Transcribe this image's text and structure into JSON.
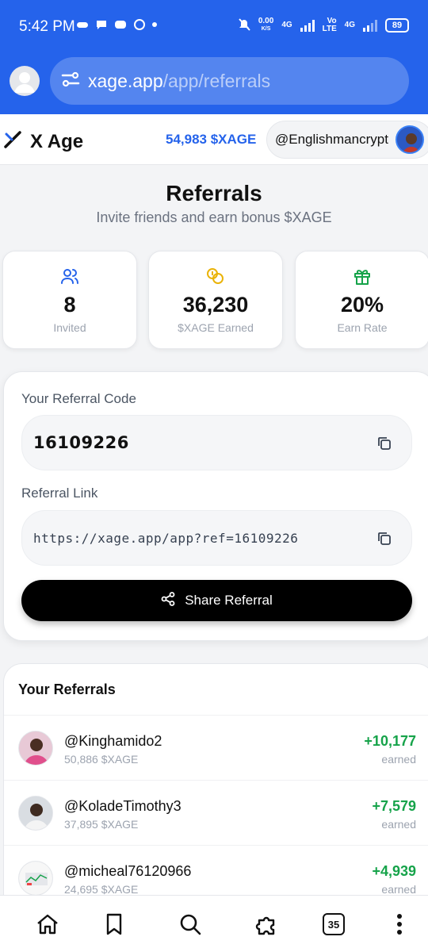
{
  "status_bar": {
    "time": "5:42 PM",
    "net_speed_value": "0.00",
    "net_speed_unit": "K/S",
    "sim1_label": "4G",
    "volte_label": "Vo LTE",
    "sim2_label": "4G",
    "battery": "89"
  },
  "browser": {
    "url_host": "xage.app",
    "url_path": "/app/referrals"
  },
  "app_header": {
    "logo_text": "X Age",
    "balance": "54,983 $XAGE",
    "username": "@Englishmancrypt"
  },
  "page": {
    "title": "Referrals",
    "subtitle": "Invite friends and earn bonus $XAGE"
  },
  "stats": [
    {
      "icon": "users-icon",
      "value": "8",
      "label": "Invited",
      "color": "#2563eb"
    },
    {
      "icon": "coins-icon",
      "value": "36,230",
      "label": "$XAGE Earned",
      "color": "#eab308"
    },
    {
      "icon": "gift-icon",
      "value": "20%",
      "label": "Earn Rate",
      "color": "#16a34a"
    }
  ],
  "referral": {
    "code_label": "Your Referral Code",
    "code": "16109226",
    "link_label": "Referral Link",
    "link": "https://xage.app/app?ref=16109226",
    "share_label": "Share Referral"
  },
  "referrals_list": {
    "heading": "Your Referrals",
    "items": [
      {
        "name": "@Kinghamido2",
        "balance": "50,886 $XAGE",
        "amount": "+10,177",
        "earned_label": "earned"
      },
      {
        "name": "@KoladeTimothy3",
        "balance": "37,895 $XAGE",
        "amount": "+7,579",
        "earned_label": "earned"
      },
      {
        "name": "@micheal76120966",
        "balance": "24,695 $XAGE",
        "amount": "+4,939",
        "earned_label": "earned"
      }
    ]
  },
  "bottom_nav": {
    "tab_count": "35"
  },
  "colors": {
    "brand_blue": "#2563eb",
    "earned_green": "#16a34a"
  }
}
